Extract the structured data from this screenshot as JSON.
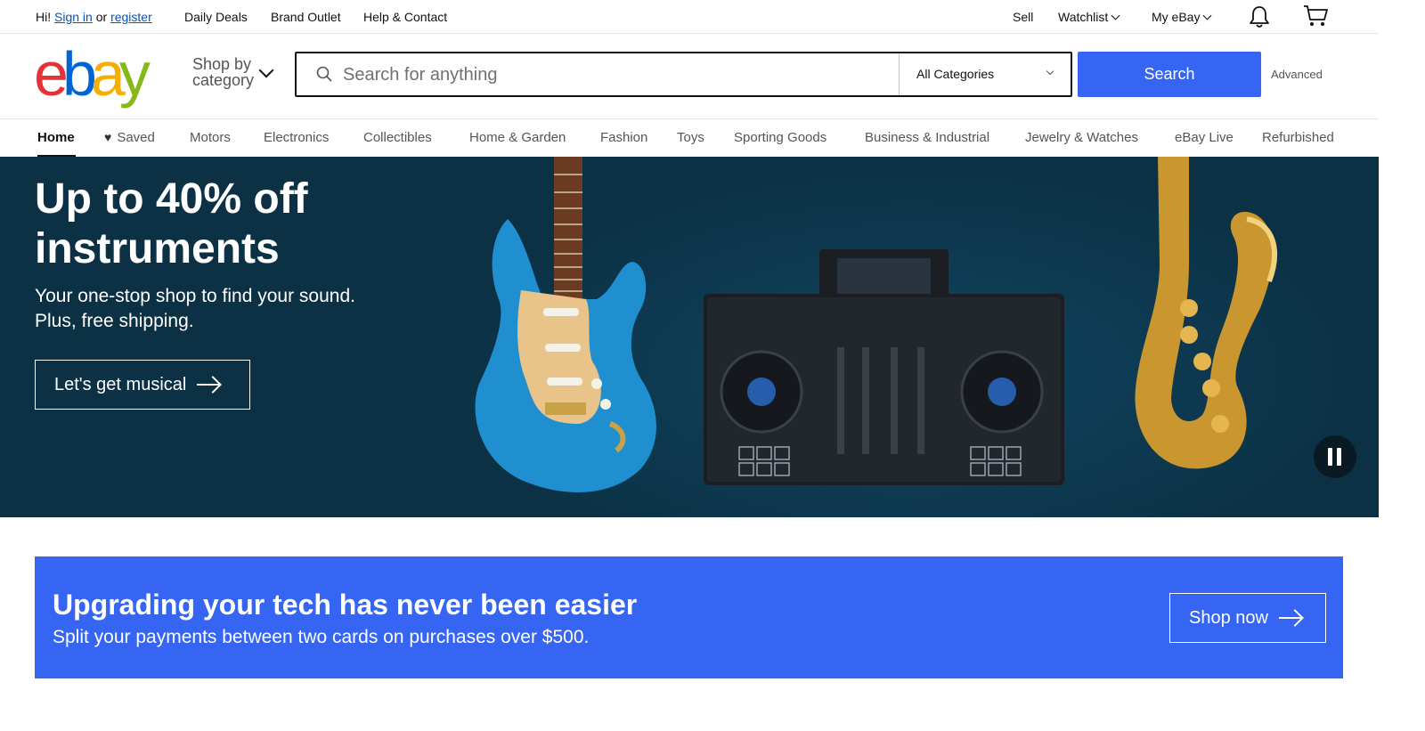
{
  "topbar": {
    "greeting": "Hi!",
    "sign_in": "Sign in",
    "or": "or",
    "register": "register",
    "daily_deals": "Daily Deals",
    "brand_outlet": "Brand Outlet",
    "help": "Help & Contact",
    "sell": "Sell",
    "watchlist": "Watchlist",
    "my_ebay": "My eBay",
    "icons": [
      "bell-icon",
      "cart-icon"
    ]
  },
  "header": {
    "logo_letters": [
      "e",
      "b",
      "a",
      "y"
    ],
    "logo_colors": [
      "#e53238",
      "#0064d2",
      "#f5af02",
      "#86b817"
    ],
    "shop_by_line1": "Shop by",
    "shop_by_line2": "category",
    "search_placeholder": "Search for anything",
    "category_selected": "All Categories",
    "search_button": "Search",
    "advanced": "Advanced",
    "accent_color": "#3665f3"
  },
  "nav": {
    "items": [
      "Home",
      "Saved",
      "Motors",
      "Electronics",
      "Collectibles",
      "Home & Garden",
      "Fashion",
      "Toys",
      "Sporting Goods",
      "Business & Industrial",
      "Jewelry & Watches",
      "eBay Live",
      "Refurbished"
    ],
    "active": "Home"
  },
  "hero": {
    "title": "Up to 40% off instruments",
    "subtitle": "Your one-stop shop to find your sound. Plus, free shipping.",
    "cta": "Let's get musical",
    "background_color": "#0c3145",
    "images": [
      "guitar-image",
      "dj-controller-image",
      "saxophone-image"
    ]
  },
  "promo": {
    "title": "Upgrading your tech has never been easier",
    "subtitle": "Split your payments between two cards on purchases over $500.",
    "cta": "Shop now"
  }
}
